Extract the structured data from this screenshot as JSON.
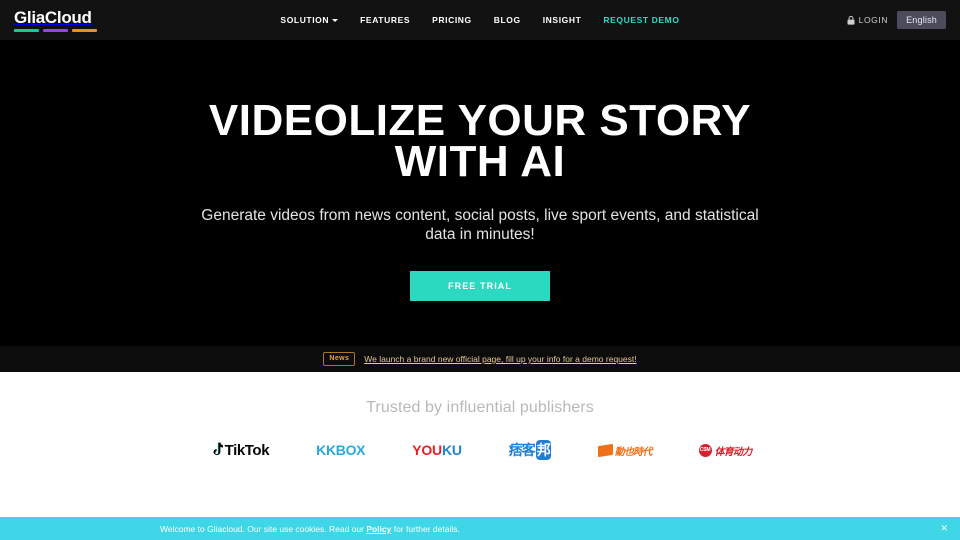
{
  "header": {
    "logo": {
      "text": "GliaCloud",
      "bar_colors": [
        "#19c79a",
        "#8b4ddb",
        "#e8921e"
      ]
    },
    "nav": [
      {
        "label": "SOLUTION",
        "has_dropdown": true,
        "accent": false
      },
      {
        "label": "FEATURES",
        "has_dropdown": false,
        "accent": false
      },
      {
        "label": "PRICING",
        "has_dropdown": false,
        "accent": false
      },
      {
        "label": "BLOG",
        "has_dropdown": false,
        "accent": false
      },
      {
        "label": "INSIGHT",
        "has_dropdown": false,
        "accent": false
      },
      {
        "label": "REQUEST DEMO",
        "has_dropdown": false,
        "accent": true
      }
    ],
    "login_label": "LOGIN",
    "login_icon": "lock-icon",
    "language_label": "English",
    "accent_color": "#2fd9c4",
    "background_color": "#121212"
  },
  "hero": {
    "title": "VIDEOLIZE YOUR STORY WITH AI",
    "subtitle": "Generate videos from news content, social posts, live sport events, and statistical data in minutes!",
    "cta_label": "FREE TRIAL",
    "cta_color": "#2bd9c0",
    "background_color": "#000000"
  },
  "news": {
    "badge": "News",
    "link_text": "We launch a brand new official page, fill up your info for a demo request!",
    "badge_color": "#e8a33d",
    "background_color": "#0c0c0c"
  },
  "publishers": {
    "title": "Trusted by influential publishers",
    "logos": [
      {
        "name": "tiktok",
        "label": "TikTok",
        "color": "#050505"
      },
      {
        "name": "kkbox",
        "label": "KKBOX",
        "color": "#29a8df"
      },
      {
        "name": "youku",
        "label_part1": "YOU",
        "label_part2": "KU",
        "color1": "#ea1f27",
        "color2": "#1d85d0"
      },
      {
        "name": "pixnet",
        "label_part1": "痞客",
        "label_part2": "邦",
        "color": "#1e7fd4"
      },
      {
        "name": "dongli-shidai",
        "label": "動也時代",
        "color": "#f07017"
      },
      {
        "name": "csm-tiyu-dongli",
        "mark_label": "CSM",
        "label": "体育动力",
        "color": "#d8202c"
      }
    ]
  },
  "cookie": {
    "text_before": "Welcome to Gliacloud. Our site use cookies. Read our ",
    "policy_label": "Policy",
    "text_after": " for further details.",
    "close_label": "✕",
    "background_color": "#3fd6e8"
  }
}
